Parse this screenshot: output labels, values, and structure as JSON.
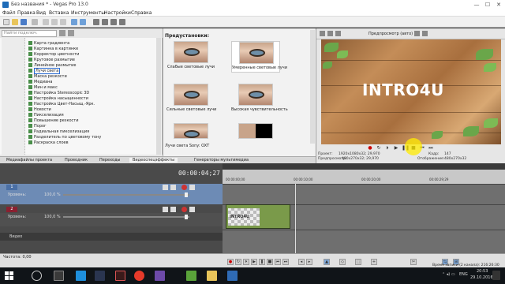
{
  "window": {
    "title": "Без названия * - Vegas Pro 13.0",
    "minimize": "—",
    "maximize": "☐",
    "close": "✕"
  },
  "menu": [
    "Файл",
    "Правка",
    "Вид",
    "Вставка",
    "Инструменты",
    "Настройки",
    "Справка"
  ],
  "browser": {
    "search_placeholder": "Найти подключ.",
    "effects": [
      "Карта градиента",
      "Картинка в картинке",
      "Корректор цветности",
      "Круговое размытие",
      "Линейное размытие",
      "Лучи света",
      "Маска резкости",
      "Медиана",
      "Мин и макс",
      "Настройка Stereoscopic 3D",
      "Настройка насыщенности",
      "Настройка Цвет-Насыщ.-Ярк.",
      "Новости",
      "Пикселизация",
      "Повышение резкости",
      "Порог",
      "Радиальная пикселизация",
      "Разделитель по цветовому тону",
      "Раскраска слоев"
    ],
    "selected_index": 5
  },
  "presets": {
    "header": "Предустановки:",
    "items": [
      "Слабые световые лучи",
      "Умеренные световые лучи",
      "Сильные световые лучи",
      "Высокая чувствительность",
      "",
      ""
    ],
    "status": "Лучи света Sony: OXT"
  },
  "tabs": [
    "Медиафайлы проекта",
    "Проводник",
    "Переходы",
    "Видеоспецэффекты",
    "Генераторы мультимедиа"
  ],
  "preview": {
    "mode": "Предпросмотр (авто)",
    "video_title": "INTRO4U",
    "info": {
      "project_label": "Проект:",
      "project_value": "1920x1080x32; 29,970",
      "preview_label": "Предпросмотр:",
      "preview_value": "480x270x32; 29,970",
      "frame_label": "Кадр:",
      "frame_value": "147",
      "display_label": "Отображение:",
      "display_value": "480x270x32"
    }
  },
  "timeline": {
    "timecode": "00:00:04;27",
    "tracks": [
      {
        "num": "1",
        "level_label": "Уровень:",
        "level_value": "100,0 %",
        "color": "#4a6fa5"
      },
      {
        "num": "2",
        "level_label": "Уровень:",
        "level_value": "100,0 %",
        "color": "#8a2030"
      }
    ],
    "video_label": "Видео",
    "ruler": [
      "00:00:00;00",
      "00:00:10;00",
      "00:00:20;00",
      "00:00:29;29"
    ],
    "clip_label": "INTRO4U"
  },
  "bottom": {
    "rate": "Частота: 0,00",
    "record_time": "Время записи (2 канала): 216:26:30"
  },
  "taskbar": {
    "time": "20:53",
    "date": "29.10.2016",
    "lang": "ENG"
  },
  "colors": {
    "accent": "#2a6bd1",
    "track1": "#4a6fa5",
    "track2": "#8a2030",
    "clip": "#7a9a4a",
    "highlight": "#ffeb00"
  }
}
